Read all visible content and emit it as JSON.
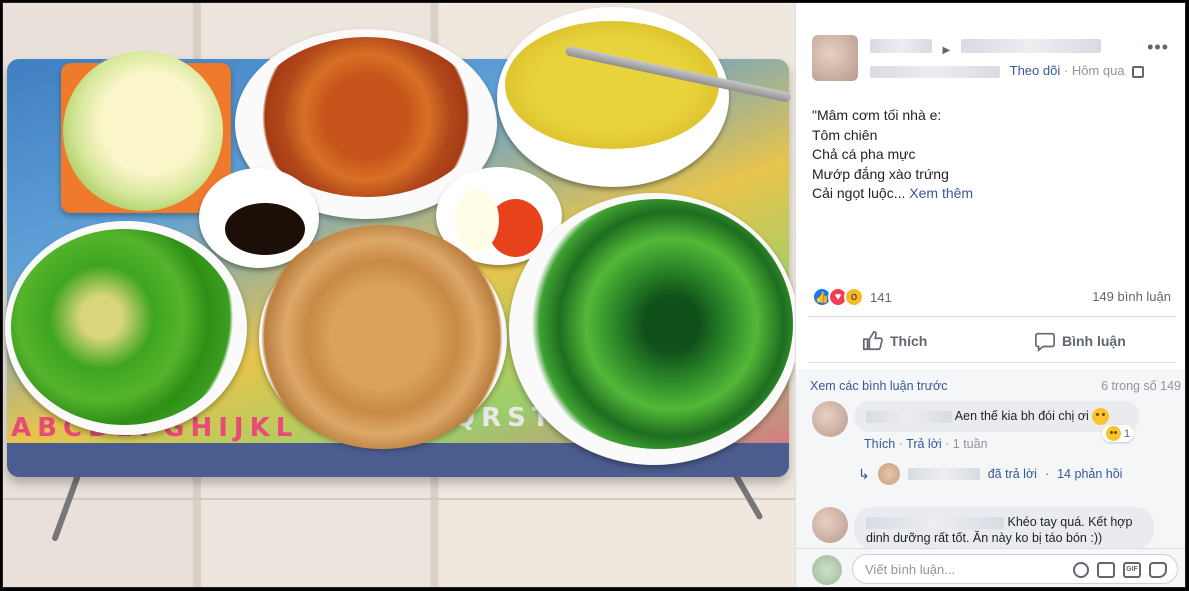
{
  "post": {
    "follow_label": "Theo dõi",
    "separator": "·",
    "time": "Hôm qua",
    "text_lines": [
      "\"Mâm cơm tối nhà e:",
      "Tôm chiên",
      "Chả cá pha mực",
      "Mướp đắng xào trứng",
      "Cải ngọt luộc..."
    ],
    "see_more": "Xem thêm",
    "reaction_count": "141",
    "comment_count": "149 bình luận",
    "like_label": "Thích",
    "comment_label": "Bình luận"
  },
  "comments": {
    "view_previous": "Xem các bình luận trước",
    "count_of": "6 trong số 149",
    "items": [
      {
        "text": "Aen thế kia bh đói chị ơi",
        "reaction_count": "1",
        "like": "Thích",
        "reply": "Trả lời",
        "time": "1 tuần",
        "replied_label": "đã trả lời",
        "replies_count": "14 phản hồi"
      },
      {
        "text": "Khéo tay quá. Kết hợp dinh dưỡng rất tốt. Ăn này ko bị táo bón :))"
      }
    ],
    "write_placeholder": "Viết bình luận..."
  },
  "icons": [
    "more-icon",
    "like-icon",
    "comment-icon",
    "emoji-icon",
    "camera-icon",
    "gif-icon",
    "sticker-icon"
  ],
  "colors": {
    "link": "#385898",
    "like": "#1877f2",
    "love": "#f33e58",
    "wow": "#f7b928"
  }
}
